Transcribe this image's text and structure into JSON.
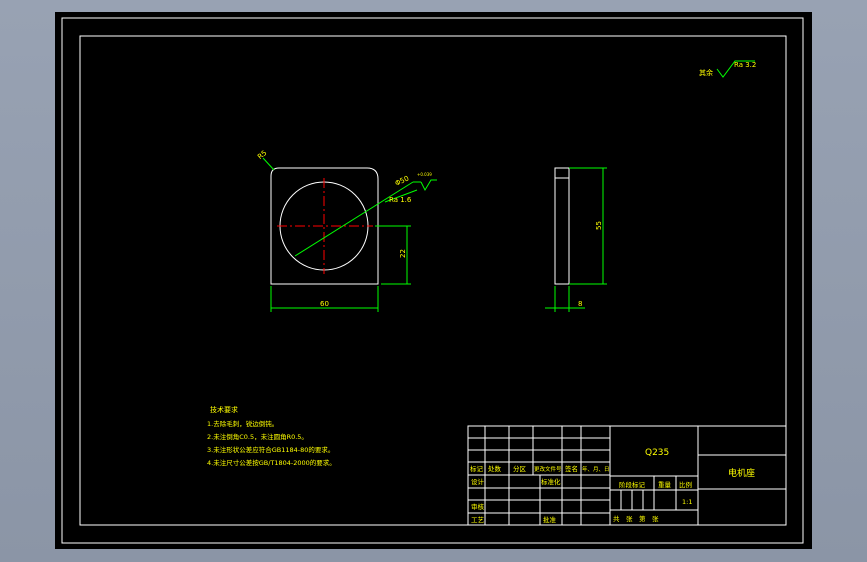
{
  "drawing": {
    "roughness_symbol": "Ra 3.2",
    "roughness_prefix": "其余",
    "front_view": {
      "chamfer": "R5",
      "hole_dia": "Φ50",
      "hole_tol": "+0.039",
      "hole_roughness": "Ra 1.6",
      "dim_height": "22",
      "dim_width": "60"
    },
    "side_view": {
      "dim_height": "55",
      "dim_thickness": "8"
    },
    "tech_req": {
      "title": "技术要求",
      "items": [
        "1.去除毛刺，锐边倒钝。",
        "2.未注倒角C0.5，未注圆角R0.5。",
        "3.未注形状公差应符合GB1184-80的要求。",
        "4.未注尺寸公差按GB/T1804-2000的要求。"
      ]
    },
    "title_block": {
      "material": "Q235",
      "part_name": "电机座",
      "scale": "1:1",
      "header_labels": [
        "标记",
        "处数",
        "分区",
        "更改文件号",
        "签名",
        "年、月、日"
      ],
      "row_design": "设计",
      "row_standard": "标准化",
      "row_check": "审核",
      "row_process": "工艺",
      "row_approve": "批准",
      "stage_label": "阶段标记",
      "weight_label": "重量",
      "scale_label": "比例",
      "sheet_label": "共　张　第　张"
    }
  }
}
